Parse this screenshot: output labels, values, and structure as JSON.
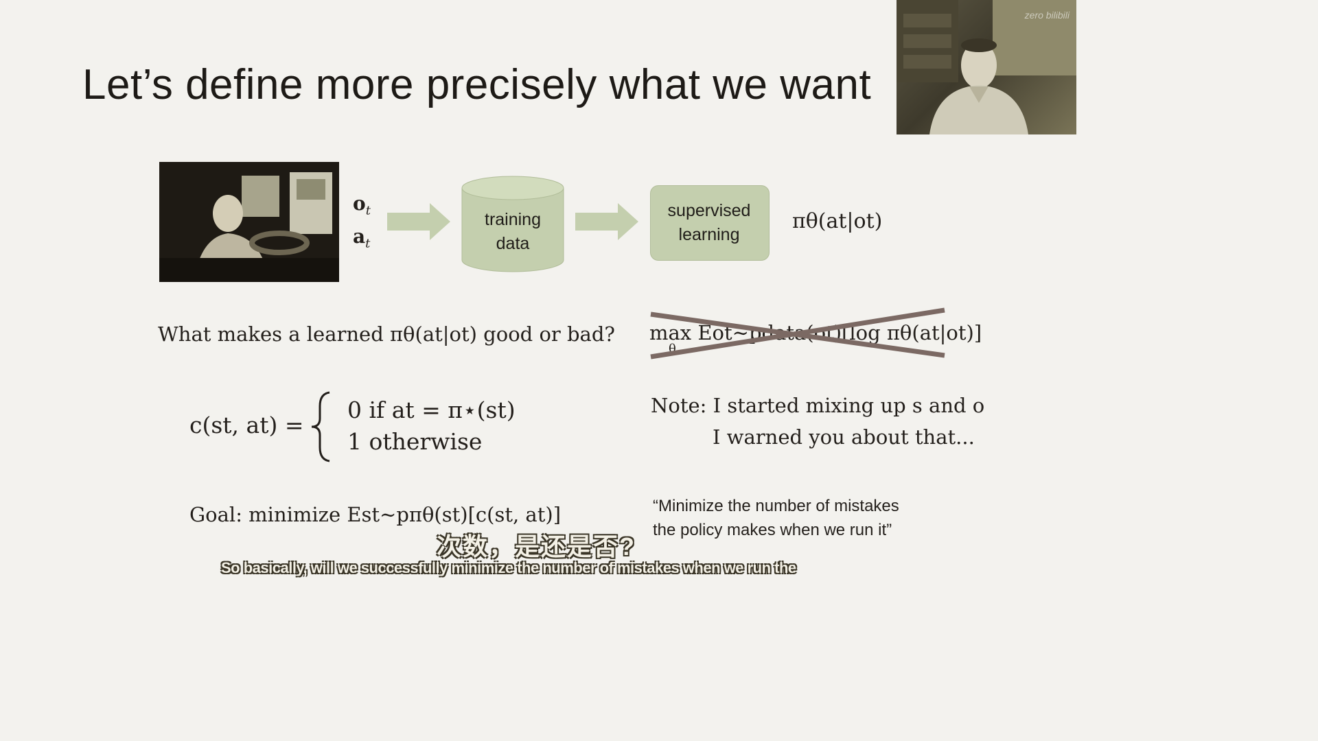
{
  "slide": {
    "title": "Let’s define more precisely what we want",
    "diagram": {
      "obs_label": "o",
      "obs_sub": "t",
      "act_label": "a",
      "act_sub": "t",
      "training_line1": "training",
      "training_line2": "data",
      "supervised_line1": "supervised",
      "supervised_line2": "learning",
      "policy": "πθ(at|ot)"
    },
    "question": "What makes a learned πθ(at|ot) good or bad?",
    "crossed_expression": "max Eot∼pdata(ot)[log πθ(at|ot)]",
    "crossed_subscript": "θ",
    "cost": {
      "lhs": "c(st, at) =",
      "case1": "0 if at = π⋆(st)",
      "case2": "1 otherwise"
    },
    "note_line1": "Note:  I started mixing up s and o",
    "note_line2": "I warned you about that...",
    "goal": "Goal:  minimize Est∼pπθ(st)[c(st, at)]",
    "quote_line1": "“Minimize the number of mistakes",
    "quote_line2": "the policy makes when we run it”"
  },
  "subtitles": {
    "chinese": "次数，是还是否?",
    "english": "So basically, will we successfully minimize the number of mistakes when we run the"
  },
  "overlay": {
    "watermark": "zero bilibili"
  },
  "colors": {
    "background": "#f3f2ee",
    "box_fill": "#c4cfae",
    "arrow_fill": "#c4cfae",
    "strike": "#7b6963",
    "text": "#231f1b"
  },
  "icons": {
    "arrow": "right-arrow-icon",
    "cylinder": "database-cylinder-icon"
  }
}
